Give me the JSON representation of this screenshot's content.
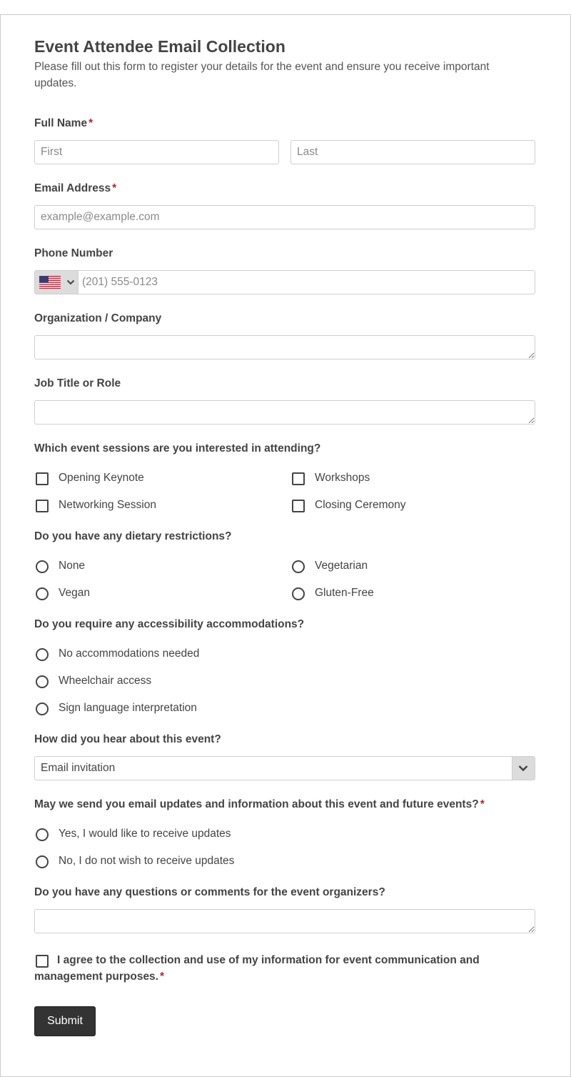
{
  "form": {
    "title": "Event Attendee Email Collection",
    "description": "Please fill out this form to register your details for the event and ensure you receive important updates.",
    "required_mark": "*",
    "full_name": {
      "label": "Full Name",
      "first_placeholder": "First",
      "last_placeholder": "Last"
    },
    "email": {
      "label": "Email Address",
      "placeholder": "example@example.com"
    },
    "phone": {
      "label": "Phone Number",
      "placeholder": "(201) 555-0123",
      "country_flag": "us-flag-icon"
    },
    "organization": {
      "label": "Organization / Company"
    },
    "job_title": {
      "label": "Job Title or Role"
    },
    "sessions": {
      "label": "Which event sessions are you interested in attending?",
      "options": [
        "Opening Keynote",
        "Workshops",
        "Networking Session",
        "Closing Ceremony"
      ]
    },
    "dietary": {
      "label": "Do you have any dietary restrictions?",
      "options": [
        "None",
        "Vegetarian",
        "Vegan",
        "Gluten-Free"
      ]
    },
    "accessibility": {
      "label": "Do you require any accessibility accommodations?",
      "options": [
        "No accommodations needed",
        "Wheelchair access",
        "Sign language interpretation"
      ]
    },
    "heard_about": {
      "label": "How did you hear about this event?",
      "selected": "Email invitation"
    },
    "email_updates": {
      "label": "May we send you email updates and information about this event and future events?",
      "options": [
        "Yes, I would like to receive updates",
        "No, I do not wish to receive updates"
      ]
    },
    "comments": {
      "label": "Do you have any questions or comments for the event organizers?"
    },
    "consent": {
      "label": "I agree to the collection and use of my information for event communication and management purposes."
    },
    "submit_label": "Submit"
  },
  "colors": {
    "required": "#c0232f",
    "button": "#333333",
    "text": "#444444",
    "border": "#cfcfcf"
  }
}
